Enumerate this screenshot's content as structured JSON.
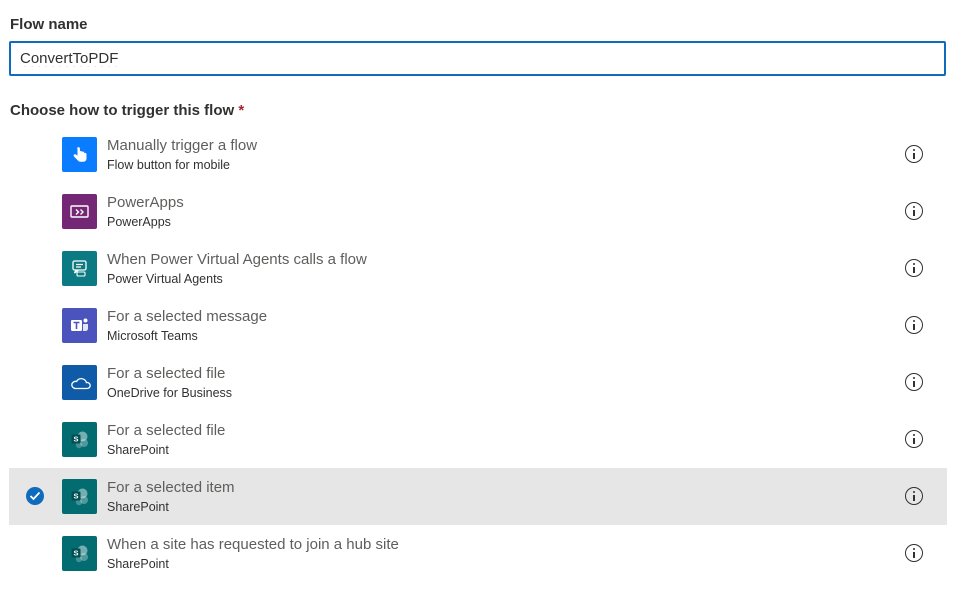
{
  "flow_name": {
    "label": "Flow name",
    "value": "ConvertToPDF"
  },
  "trigger": {
    "label": "Choose how to trigger this flow",
    "required_marker": "*",
    "selected_index": 6,
    "items": [
      {
        "title": "Manually trigger a flow",
        "subtitle": "Flow button for mobile",
        "icon": "hand-tap-icon",
        "color": "#0a7cff"
      },
      {
        "title": "PowerApps",
        "subtitle": "PowerApps",
        "icon": "powerapps-icon",
        "color": "#742774"
      },
      {
        "title": "When Power Virtual Agents calls a flow",
        "subtitle": "Power Virtual Agents",
        "icon": "chat-bot-icon",
        "color": "#0b7a82"
      },
      {
        "title": "For a selected message",
        "subtitle": "Microsoft Teams",
        "icon": "teams-icon",
        "color": "#4b53bc"
      },
      {
        "title": "For a selected file",
        "subtitle": "OneDrive for Business",
        "icon": "onedrive-icon",
        "color": "#0f5ba8"
      },
      {
        "title": "For a selected file",
        "subtitle": "SharePoint",
        "icon": "sharepoint-icon",
        "color": "#036c70"
      },
      {
        "title": "For a selected item",
        "subtitle": "SharePoint",
        "icon": "sharepoint-icon",
        "color": "#036c70"
      },
      {
        "title": "When a site has requested to join a hub site",
        "subtitle": "SharePoint",
        "icon": "sharepoint-icon",
        "color": "#036c70"
      }
    ]
  },
  "colors": {
    "accent": "#0f6cbd",
    "selected_row": "#e6e6e6",
    "required": "#a4262c"
  }
}
